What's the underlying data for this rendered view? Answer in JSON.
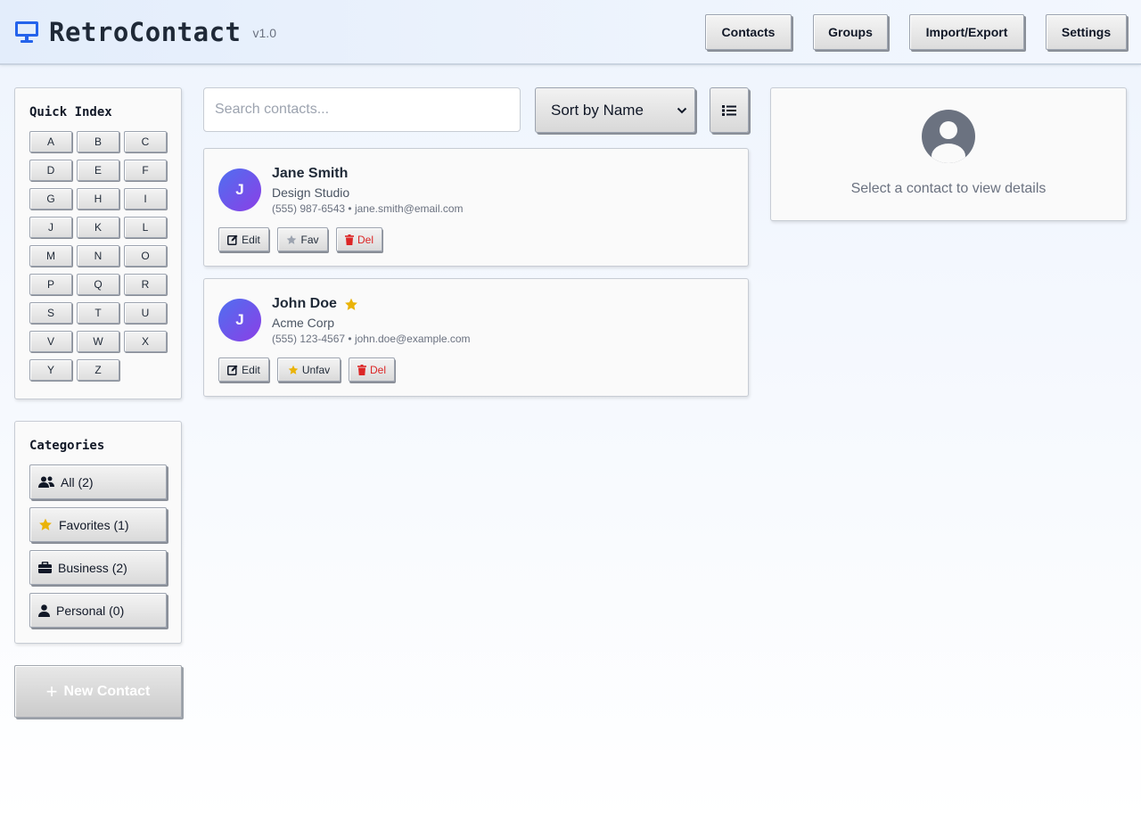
{
  "app": {
    "title": "RetroContact",
    "version": "v1.0"
  },
  "nav": [
    "Contacts",
    "Groups",
    "Import/Export",
    "Settings"
  ],
  "quick_index": {
    "title": "Quick Index",
    "letters": [
      "A",
      "B",
      "C",
      "D",
      "E",
      "F",
      "G",
      "H",
      "I",
      "J",
      "K",
      "L",
      "M",
      "N",
      "O",
      "P",
      "Q",
      "R",
      "S",
      "T",
      "U",
      "V",
      "W",
      "X",
      "Y",
      "Z"
    ]
  },
  "categories": {
    "title": "Categories",
    "items": [
      {
        "label": "All (2)",
        "icon": "users-icon"
      },
      {
        "label": "Favorites (1)",
        "icon": "star-icon"
      },
      {
        "label": "Business (2)",
        "icon": "briefcase-icon"
      },
      {
        "label": "Personal (0)",
        "icon": "user-icon"
      }
    ]
  },
  "new_contact": {
    "label": "New Contact",
    "icon": "plus-icon"
  },
  "search": {
    "placeholder": "Search contacts...",
    "value": ""
  },
  "sort": {
    "selected": "Sort by Name"
  },
  "view_toggle": {
    "icon": "list-icon"
  },
  "contacts": [
    {
      "initial": "J",
      "name": "Jane Smith",
      "company": "Design Studio",
      "phone": "(555) 987-6543",
      "separator": "•",
      "email": "jane.smith@email.com",
      "favorite": false,
      "actions": {
        "edit": "Edit",
        "fav": "Fav",
        "del": "Del"
      }
    },
    {
      "initial": "J",
      "name": "John Doe",
      "company": "Acme Corp",
      "phone": "(555) 123-4567",
      "separator": "•",
      "email": "john.doe@example.com",
      "favorite": true,
      "actions": {
        "edit": "Edit",
        "fav": "Unfav",
        "del": "Del"
      }
    }
  ],
  "detail": {
    "empty_text": "Select a contact to view details"
  },
  "colors": {
    "brand": "#2563eb",
    "avatar_start": "#4f6ff0",
    "avatar_end": "#8b3fe6",
    "favorite": "#eab308",
    "danger": "#dc2626"
  }
}
